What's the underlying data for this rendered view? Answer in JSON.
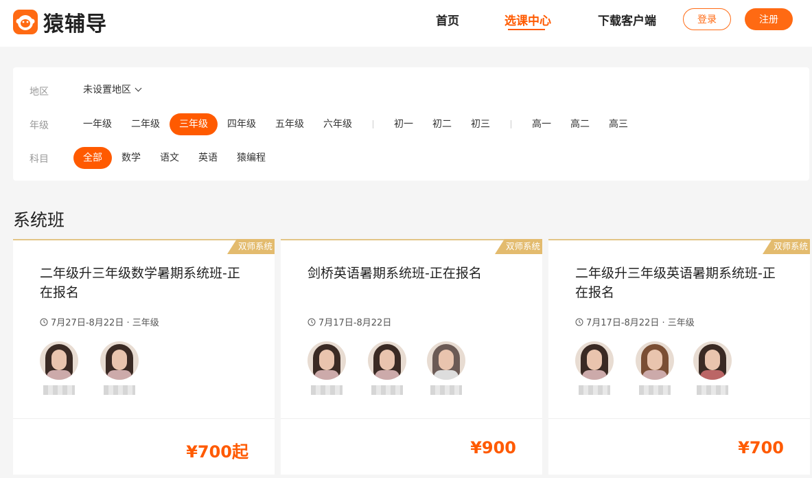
{
  "header": {
    "brand": "猿辅导",
    "nav": [
      "首页",
      "选课中心",
      "下载客户端"
    ],
    "login": "登录",
    "register": "注册",
    "colors": {
      "accent": "#ff5a00",
      "tag": "#e3bb6e"
    }
  },
  "filters": {
    "region": {
      "label": "地区",
      "value": "未设置地区"
    },
    "grade": {
      "label": "年级",
      "options": [
        "一年级",
        "二年级",
        "三年级",
        "四年级",
        "五年级",
        "六年级",
        "初一",
        "初二",
        "初三",
        "高一",
        "高二",
        "高三"
      ],
      "selected": "三年级"
    },
    "subject": {
      "label": "科目",
      "options": [
        "全部",
        "数学",
        "语文",
        "英语",
        "猿编程"
      ],
      "selected": "全部"
    }
  },
  "section": {
    "title": "系统班"
  },
  "cards": [
    {
      "tag": "双师系统",
      "title": "二年级升三年级数学暑期系统班-正在报名",
      "meta": "7月27日-8月22日 · 三年级",
      "teachers": 2,
      "price": "¥700起"
    },
    {
      "tag": "双师系统",
      "title": "剑桥英语暑期系统班-正在报名",
      "meta": "7月17日-8月22日",
      "teachers": 3,
      "price": "¥900"
    },
    {
      "tag": "双师系统",
      "title": "二年级升三年级英语暑期系统班-正在报名",
      "meta": "7月17日-8月22日 · 三年级",
      "teachers": 3,
      "price": "¥700"
    }
  ]
}
